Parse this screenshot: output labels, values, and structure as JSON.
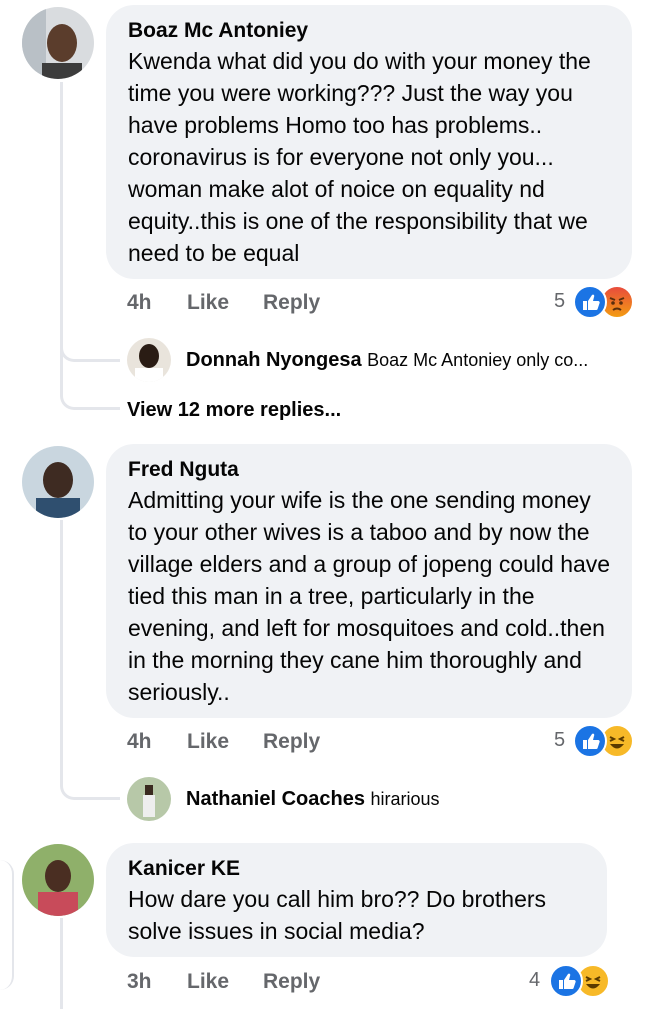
{
  "comments": [
    {
      "author": "Boaz Mc Antoniey",
      "text": "Kwenda what did you do with your money the time you were working??? Just the way you have problems Homo too has problems.. coronavirus is for everyone not only you... woman make alot of noice on equality nd equity..this is one of the responsibility that we need to be equal",
      "time": "4h",
      "like_label": "Like",
      "reply_label": "Reply",
      "reaction_count": "5",
      "reactions": [
        "like-icon",
        "angry-icon"
      ],
      "reply": {
        "author": "Donnah Nyongesa",
        "text": "Boaz Mc Antoniey only co..."
      },
      "view_more": "View 12 more replies..."
    },
    {
      "author": "Fred Nguta",
      "text": "Admitting your wife is the one sending money to your other wives is a taboo and by now the village elders and a group of jopeng could have tied this man in a tree, particularly in the evening, and left for mosquitoes and cold..then in the morning they cane him thoroughly and seriously..",
      "time": "4h",
      "like_label": "Like",
      "reply_label": "Reply",
      "reaction_count": "5",
      "reactions": [
        "like-icon",
        "haha-icon"
      ],
      "reply": {
        "author": "Nathaniel Coaches",
        "text": "hirarious"
      }
    },
    {
      "author": "Kanicer KE",
      "text": "How dare you call him bro?? Do brothers solve issues in social media?",
      "time": "3h",
      "like_label": "Like",
      "reply_label": "Reply",
      "reaction_count": "4",
      "reactions": [
        "like-icon",
        "haha-icon"
      ]
    }
  ],
  "colors": {
    "bubble": "#f0f2f5",
    "meta": "#65676b",
    "like": "#1b74e4",
    "haha": "#f7b928",
    "angry": "#e84c3d"
  }
}
